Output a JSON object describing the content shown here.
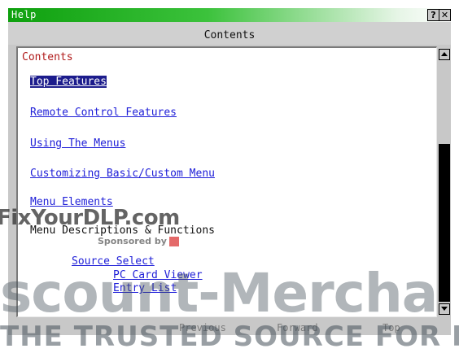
{
  "window": {
    "title": "Help",
    "help_glyph": "?",
    "close_glyph": "✕",
    "header": "Contents"
  },
  "content": {
    "heading": "Contents",
    "links": [
      {
        "label": "Top Features",
        "selected": true
      },
      {
        "label": "Remote Control Features"
      },
      {
        "label": "Using The Menus"
      },
      {
        "label": "Customizing Basic/Custom Menu"
      },
      {
        "label": "Menu Elements"
      }
    ],
    "section": "Menu Descriptions & Functions",
    "sublinks": [
      {
        "label": "Source Select"
      },
      {
        "label": "PC Card Viewer"
      },
      {
        "label": "Entry List"
      }
    ]
  },
  "footer": {
    "previous": "Previous",
    "forward": "Forward",
    "top": "Top"
  },
  "watermarks": {
    "line1": "FixYourDLP.com",
    "line2": "Sponsored by",
    "line3": "scount-Mercha",
    "line4": "THE TRUSTED SOURCE FOR R"
  },
  "colors": {
    "title_bar": "#0ea00e",
    "link": "#2020d8",
    "selected_bg": "#1c1c8c",
    "heading": "#b01a1a"
  }
}
